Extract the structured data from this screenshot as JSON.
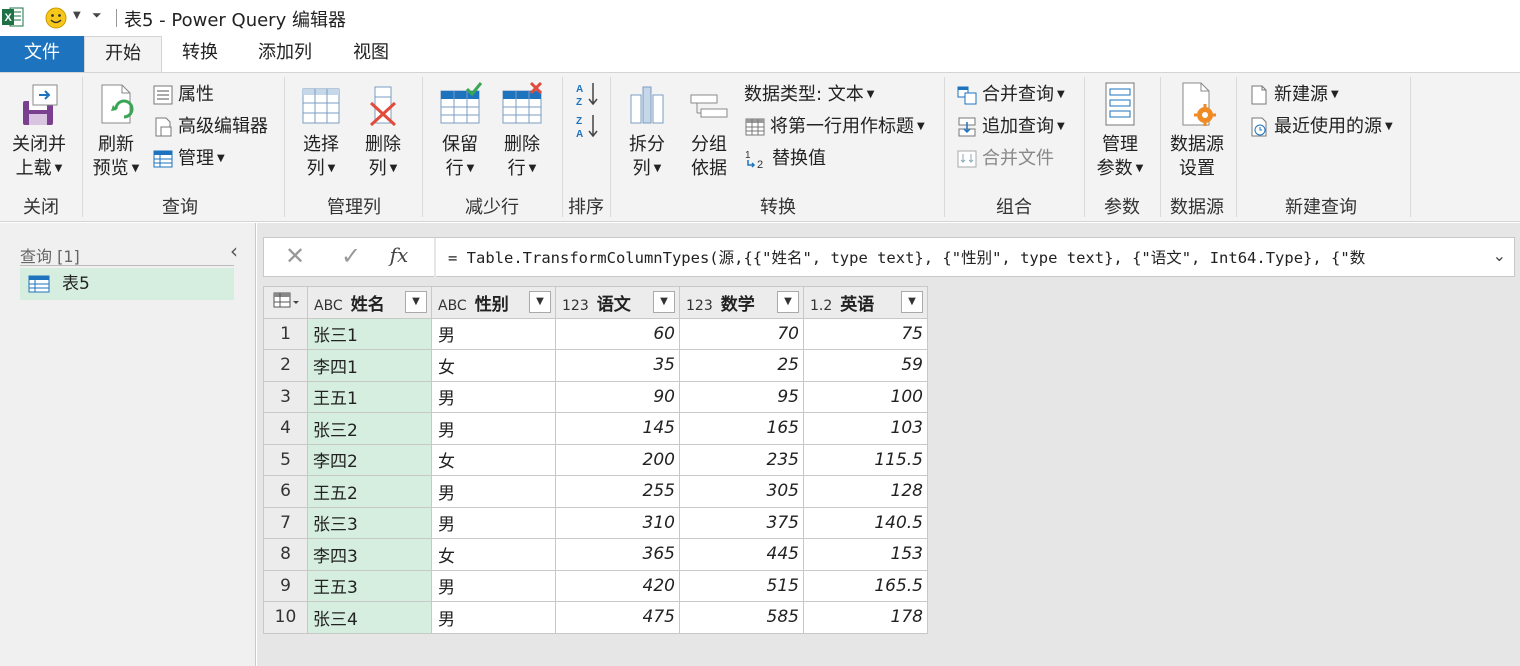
{
  "titlebar": {
    "title": "表5 - Power Query 编辑器"
  },
  "tabs": {
    "file": "文件",
    "home": "开始",
    "transform": "转换",
    "add_column": "添加列",
    "view": "视图"
  },
  "ribbon": {
    "close_load_l1": "关闭并",
    "close_load_l2": "上载",
    "group_close": "关闭",
    "refresh_l1": "刷新",
    "refresh_l2": "预览",
    "properties": "属性",
    "advanced_editor": "高级编辑器",
    "manage": "管理",
    "group_query": "查询",
    "choose_cols_l1": "选择",
    "choose_cols_l2": "列",
    "remove_cols_l1": "删除",
    "remove_cols_l2": "列",
    "group_manage_cols": "管理列",
    "keep_rows_l1": "保留",
    "keep_rows_l2": "行",
    "remove_rows_l1": "删除",
    "remove_rows_l2": "行",
    "group_reduce_rows": "减少行",
    "group_sort": "排序",
    "split_l1": "拆分",
    "split_l2": "列",
    "groupby_l1": "分组",
    "groupby_l2": "依据",
    "data_type": "数据类型: 文本",
    "first_row_headers": "将第一行用作标题",
    "replace_values": "替换值",
    "group_transform": "转换",
    "merge_queries": "合并查询",
    "append_queries": "追加查询",
    "combine_files": "合并文件",
    "group_combine": "组合",
    "manage_params_l1": "管理",
    "manage_params_l2": "参数",
    "group_params": "参数",
    "ds_settings_l1": "数据源",
    "ds_settings_l2": "设置",
    "group_datasource": "数据源",
    "new_source": "新建源",
    "recent_sources": "最近使用的源",
    "group_new_query": "新建查询"
  },
  "queries_pane": {
    "header": "查询 [1]",
    "items": [
      {
        "label": "表5"
      }
    ]
  },
  "formula_bar": {
    "fx": "fx",
    "formula": "= Table.TransformColumnTypes(源,{{\"姓名\", type text}, {\"性别\", type text}, {\"语文\", Int64.Type}, {\"数"
  },
  "table": {
    "columns": [
      {
        "type_icon": "ABC",
        "name": "姓名"
      },
      {
        "type_icon": "ABC",
        "name": "性别"
      },
      {
        "type_icon": "123",
        "name": "语文"
      },
      {
        "type_icon": "123",
        "name": "数学"
      },
      {
        "type_icon": "1.2",
        "name": "英语"
      }
    ],
    "rows": [
      {
        "n": "1",
        "name": "张三1",
        "sex": "男",
        "chinese": "60",
        "math": "70",
        "english": "75"
      },
      {
        "n": "2",
        "name": "李四1",
        "sex": "女",
        "chinese": "35",
        "math": "25",
        "english": "59"
      },
      {
        "n": "3",
        "name": "王五1",
        "sex": "男",
        "chinese": "90",
        "math": "95",
        "english": "100"
      },
      {
        "n": "4",
        "name": "张三2",
        "sex": "男",
        "chinese": "145",
        "math": "165",
        "english": "103"
      },
      {
        "n": "5",
        "name": "李四2",
        "sex": "女",
        "chinese": "200",
        "math": "235",
        "english": "115.5"
      },
      {
        "n": "6",
        "name": "王五2",
        "sex": "男",
        "chinese": "255",
        "math": "305",
        "english": "128"
      },
      {
        "n": "7",
        "name": "张三3",
        "sex": "男",
        "chinese": "310",
        "math": "375",
        "english": "140.5"
      },
      {
        "n": "8",
        "name": "李四3",
        "sex": "女",
        "chinese": "365",
        "math": "445",
        "english": "153"
      },
      {
        "n": "9",
        "name": "王五3",
        "sex": "男",
        "chinese": "420",
        "math": "515",
        "english": "165.5"
      },
      {
        "n": "10",
        "name": "张三4",
        "sex": "男",
        "chinese": "475",
        "math": "585",
        "english": "178"
      }
    ]
  }
}
